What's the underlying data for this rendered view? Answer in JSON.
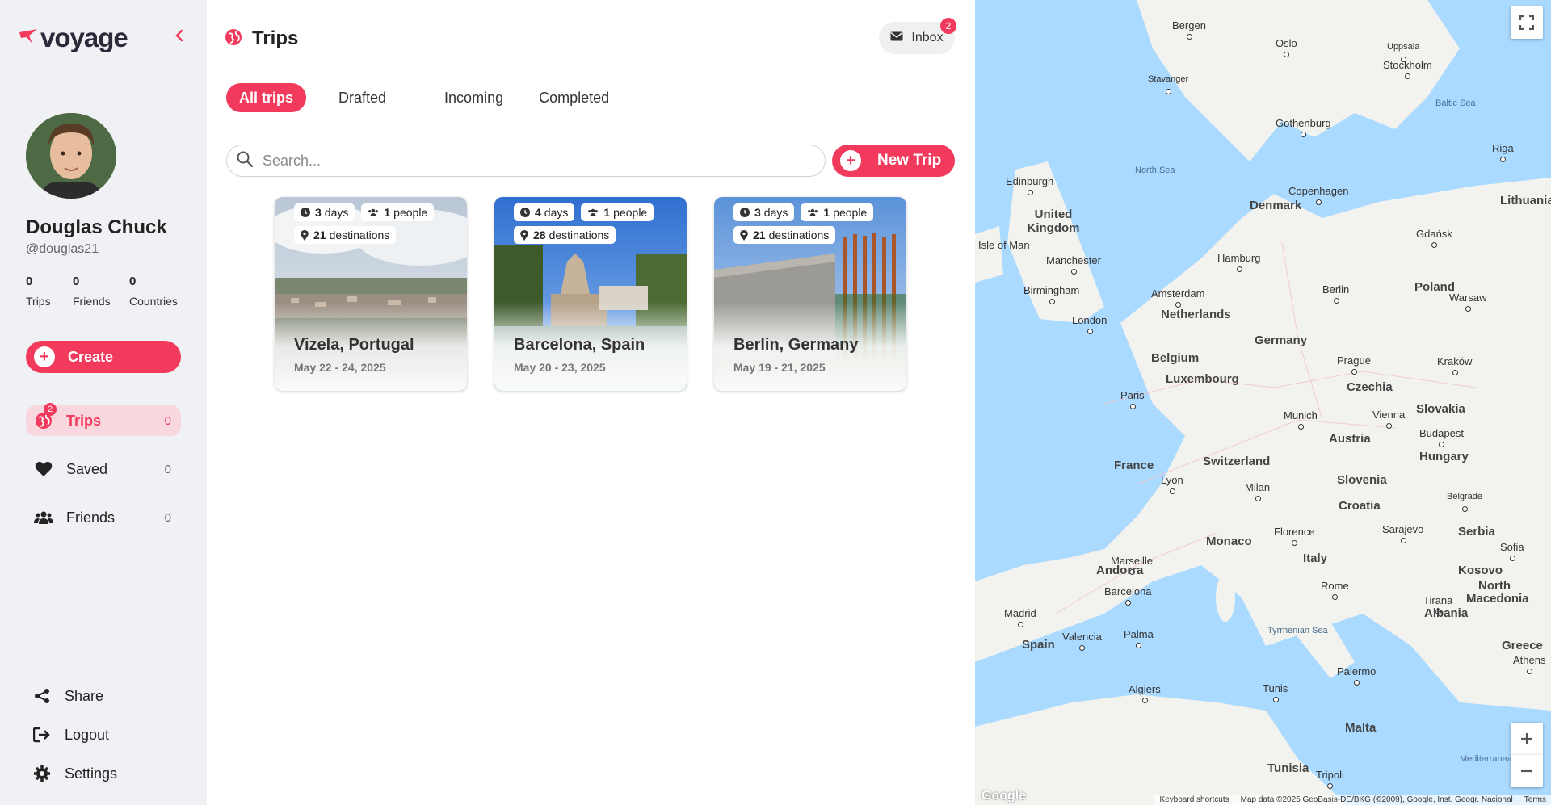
{
  "app": {
    "logo_text": "voyage",
    "accent_color": "#f23a5c"
  },
  "profile": {
    "name": "Douglas Chuck",
    "handle": "@douglas21",
    "stats": [
      {
        "value": "0",
        "label": "Trips"
      },
      {
        "value": "0",
        "label": "Friends"
      },
      {
        "value": "0",
        "label": "Countries"
      }
    ]
  },
  "sidebar": {
    "create_label": "Create",
    "nav": [
      {
        "label": "Trips",
        "count": "0",
        "badge": "2",
        "icon": "globe-icon"
      },
      {
        "label": "Saved",
        "count": "0",
        "icon": "heart-icon"
      },
      {
        "label": "Friends",
        "count": "0",
        "icon": "users-icon"
      }
    ],
    "bottom": [
      {
        "label": "Share",
        "icon": "share-icon"
      },
      {
        "label": "Logout",
        "icon": "logout-icon"
      },
      {
        "label": "Settings",
        "icon": "gear-icon"
      }
    ]
  },
  "header": {
    "title": "Trips",
    "inbox_label": "Inbox",
    "inbox_badge": "2"
  },
  "tabs": [
    "All trips",
    "Drafted",
    "Incoming",
    "Completed"
  ],
  "search": {
    "placeholder": "Search..."
  },
  "new_trip_label": "New Trip",
  "trips": [
    {
      "title": "Vizela, Portugal",
      "dates": "May 22 - 24, 2025",
      "days": "3",
      "days_label": "days",
      "people": "1",
      "people_label": "people",
      "destinations": "21",
      "destinations_label": "destinations"
    },
    {
      "title": "Barcelona, Spain",
      "dates": "May 20 - 23, 2025",
      "days": "4",
      "days_label": "days",
      "people": "1",
      "people_label": "people",
      "destinations": "28",
      "destinations_label": "destinations"
    },
    {
      "title": "Berlin, Germany",
      "dates": "May 19 - 21, 2025",
      "days": "3",
      "days_label": "days",
      "people": "1",
      "people_label": "people",
      "destinations": "21",
      "destinations_label": "destinations"
    }
  ],
  "map": {
    "countries": [
      "United Kingdom",
      "Denmark",
      "Netherlands",
      "Belgium",
      "Luxembourg",
      "Germany",
      "Poland",
      "Czechia",
      "Slovakia",
      "Austria",
      "Hungary",
      "France",
      "Switzerland",
      "Slovenia",
      "Croatia",
      "Monaco",
      "Italy",
      "Andorra",
      "Spain",
      "Serbia",
      "Kosovo",
      "North Macedonia",
      "Albania",
      "Greece",
      "Lithuania",
      "Malta",
      "Tunisia",
      "Isle of Man"
    ],
    "cities": [
      "Bergen",
      "Oslo",
      "Uppsala",
      "Stockholm",
      "Stavanger",
      "Gothenburg",
      "Riga",
      "Edinburgh",
      "Copenhagen",
      "Gdańsk",
      "Manchester",
      "Hamburg",
      "Birmingham",
      "Amsterdam",
      "Berlin",
      "Warsaw",
      "London",
      "Prague",
      "Kraków",
      "Paris",
      "Munich",
      "Vienna",
      "Budapest",
      "Lyon",
      "Milan",
      "Belgrade",
      "Florence",
      "Sarajevo",
      "Marseille",
      "Sofia",
      "Barcelona",
      "Rome",
      "Tirana",
      "Madrid",
      "Valencia",
      "Palma",
      "Athens",
      "Palermo",
      "Algiers",
      "Tunis",
      "Tripoli"
    ],
    "seas": [
      "North Sea",
      "Baltic Sea",
      "Tyrrhenian Sea",
      "Mediterranean Sea"
    ],
    "footer": [
      "Keyboard shortcuts",
      "Map data ©2025 GeoBasis-DE/BKG (©2009), Google, Inst. Geogr. Nacional",
      "Terms"
    ],
    "google_label": "Google"
  }
}
